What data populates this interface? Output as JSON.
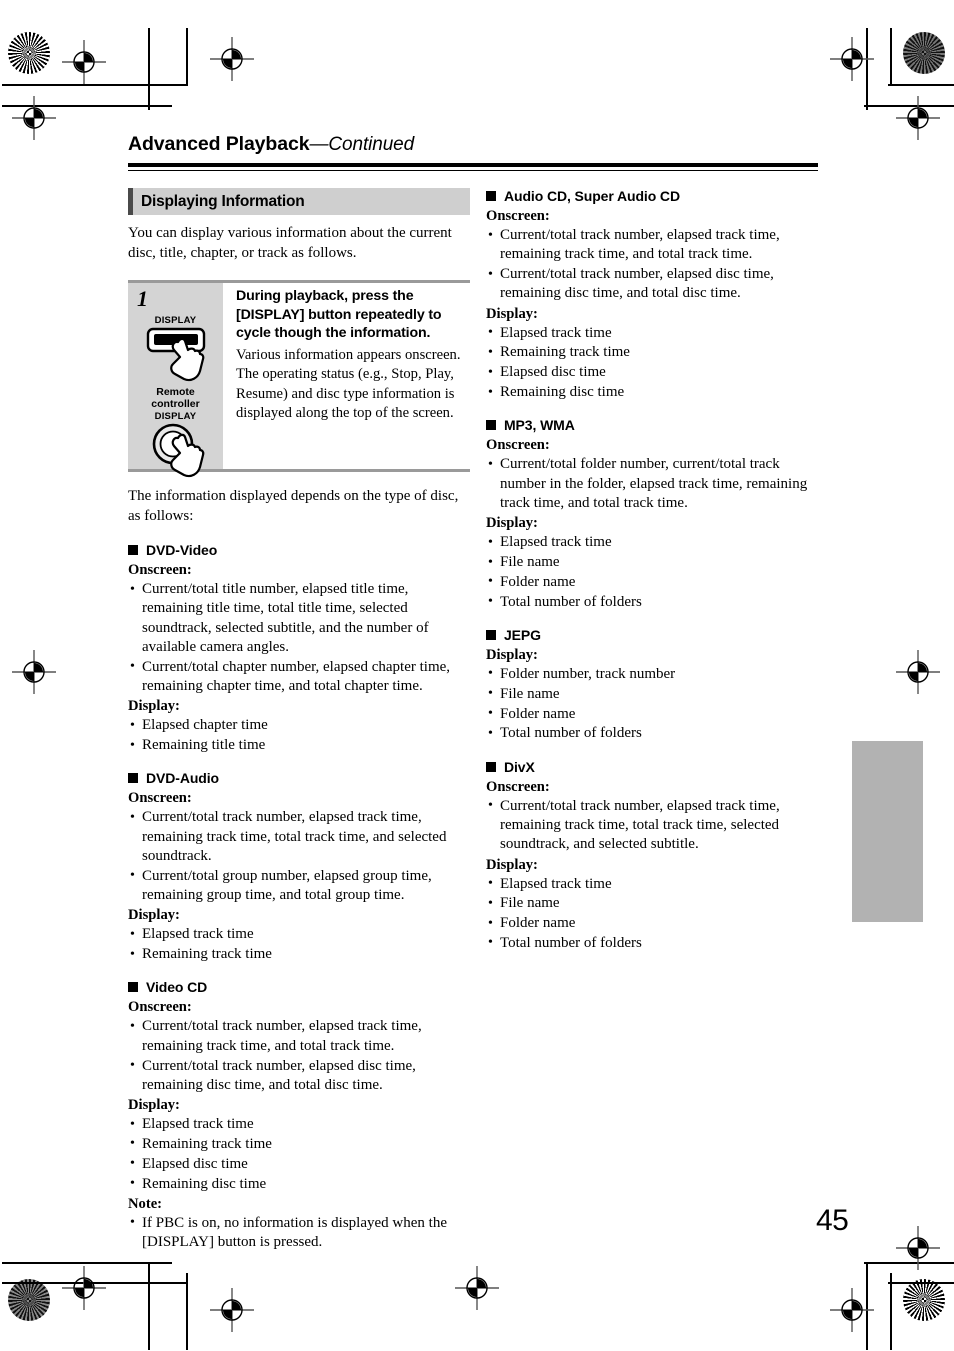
{
  "header": {
    "chapter_title": "Advanced Playback",
    "chapter_continued": "—Continued"
  },
  "page_number": "45",
  "section": {
    "title": "Displaying Information",
    "intro": "You can display various information about the current disc, title, chapter, or track as follows.",
    "after_box": "The information displayed depends on the type of disc, as follows:"
  },
  "step": {
    "number": "1",
    "heading": "During playback, press the [DISPLAY] button repeatedly to cycle though the information.",
    "body": "Various information appears onscreen. The operating status (e.g., Stop, Play, Resume) and disc type information is displayed along the top of the screen.",
    "remote_button_label_top": "DISPLAY",
    "remote_caption_line1": "Remote",
    "remote_caption_line2": "controller",
    "front_button_label": "DISPLAY"
  },
  "labels": {
    "onscreen": "Onscreen:",
    "display": "Display:",
    "note": "Note:"
  },
  "left_column": [
    {
      "name": "DVD-Video",
      "onscreen": [
        "Current/total title number, elapsed title time, remaining title time, total title time, selected soundtrack, selected subtitle, and the number of available camera angles.",
        "Current/total chapter number, elapsed chapter time, remaining chapter time, and total chapter time."
      ],
      "display": [
        "Elapsed chapter time",
        "Remaining title time"
      ]
    },
    {
      "name": "DVD-Audio",
      "onscreen": [
        "Current/total track number, elapsed track time, remaining track time, total track time, and selected soundtrack.",
        "Current/total group number, elapsed group time, remaining group time, and total group time."
      ],
      "display": [
        "Elapsed track time",
        "Remaining track time"
      ]
    },
    {
      "name": "Video CD",
      "onscreen": [
        "Current/total track number, elapsed track time, remaining track time, and total track time.",
        "Current/total track number, elapsed disc time, remaining disc time, and total disc time."
      ],
      "display": [
        "Elapsed track time",
        "Remaining track time",
        "Elapsed disc time",
        "Remaining disc time"
      ],
      "note": [
        "If PBC is on, no information is displayed when the [DISPLAY] button is pressed."
      ]
    }
  ],
  "right_column": [
    {
      "name": "Audio CD, Super Audio CD",
      "onscreen": [
        "Current/total track number, elapsed track time, remaining track time, and total track time.",
        "Current/total track number, elapsed disc time, remaining disc time, and total disc time."
      ],
      "display": [
        "Elapsed track time",
        "Remaining track time",
        "Elapsed disc time",
        "Remaining disc time"
      ]
    },
    {
      "name": "MP3, WMA",
      "onscreen": [
        "Current/total folder number, current/total track number in the folder, elapsed track time, remaining track time, and total track time."
      ],
      "display": [
        "Elapsed track time",
        "File name",
        "Folder name",
        "Total number of folders"
      ]
    },
    {
      "name": "JEPG",
      "display": [
        "Folder number, track number",
        "File name",
        "Folder name",
        "Total number of folders"
      ]
    },
    {
      "name": "DivX",
      "onscreen": [
        "Current/total track number, elapsed track time, remaining track time, total track time, selected soundtrack, and selected subtitle."
      ],
      "display": [
        "Elapsed track time",
        "File name",
        "Folder name",
        "Total number of folders"
      ]
    }
  ],
  "colors": {
    "section_bar": "#cfcfcf",
    "step_panel": "#d4d4d4",
    "thumb_tab": "#b2b2b2",
    "rule": "#000000"
  }
}
